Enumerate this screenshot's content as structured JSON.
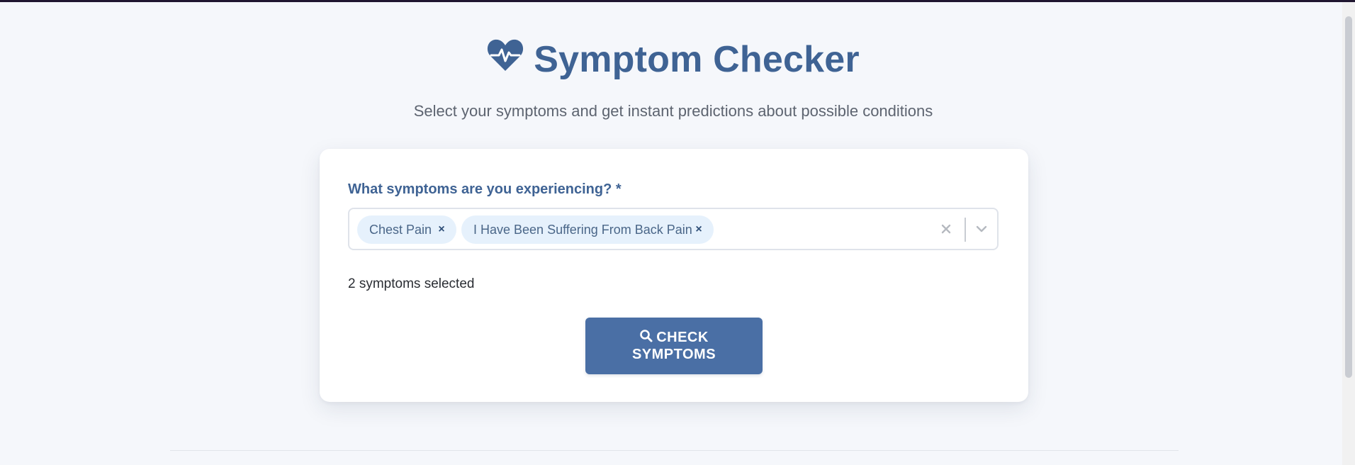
{
  "header": {
    "icon": "heart-pulse-icon",
    "title": "Symptom Checker",
    "subtitle": "Select your symptoms and get instant predictions about possible conditions"
  },
  "form": {
    "label": "What symptoms are you experiencing? *",
    "selected_symptoms": [
      {
        "label": "Chest Pain",
        "remove_icon": "close-icon"
      },
      {
        "label": "I Have Been Suffering From Back Pain",
        "remove_icon": "close-icon"
      }
    ],
    "clear_icon": "close-icon",
    "dropdown_icon": "chevron-down-icon",
    "count_text": "2 symptoms selected",
    "submit": {
      "icon": "search-icon",
      "label": "CHECK SYMPTOMS"
    }
  },
  "colors": {
    "brand": "#3f6394",
    "button": "#4a6fa5",
    "chip_bg": "#e6f1fc",
    "page_bg": "#f5f7fb"
  }
}
